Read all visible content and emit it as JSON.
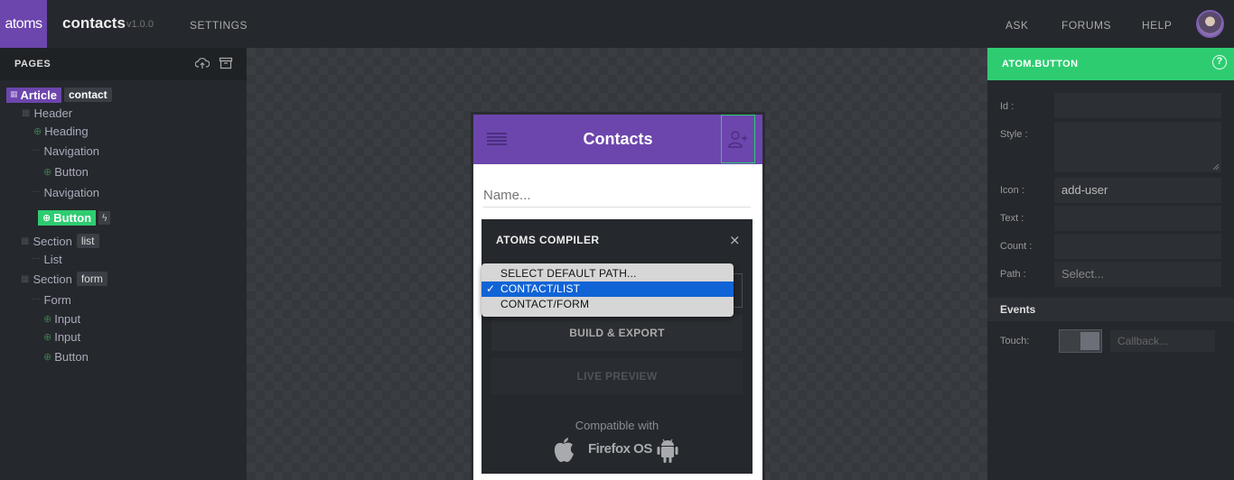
{
  "topbar": {
    "logo": "atoms",
    "app_name": "contacts",
    "version": "v1.0.0",
    "settings": "SETTINGS",
    "ask": "ASK",
    "forums": "FORUMS",
    "help": "HELP"
  },
  "pages_panel": {
    "title": "PAGES",
    "article_label": "Article",
    "article_id": "contact",
    "tree": {
      "header": "Header",
      "heading": "Heading",
      "navigation1": "Navigation",
      "button1": "Button",
      "navigation2": "Navigation",
      "button_selected": "Button",
      "section1": "Section",
      "section1_tag": "list",
      "list": "List",
      "section2": "Section",
      "section2_tag": "form",
      "form": "Form",
      "input1": "Input",
      "input2": "Input",
      "button3": "Button"
    }
  },
  "phone": {
    "title": "Contacts",
    "name_placeholder": "Name..."
  },
  "compiler_modal": {
    "title": "ATOMS COMPILER",
    "close": "×",
    "build_export": "BUILD & EXPORT",
    "live_preview": "LIVE PREVIEW",
    "compatible_with": "Compatible with",
    "firefox_os": "Firefox OS",
    "path_options": [
      "SELECT DEFAULT PATH...",
      "CONTACT/LIST",
      "CONTACT/FORM"
    ],
    "selected_path": "CONTACT/LIST",
    "check": "✓"
  },
  "properties": {
    "title": "ATOM.BUTTON",
    "help": "?",
    "id_label": "Id :",
    "style_label": "Style :",
    "icon_label": "Icon :",
    "icon_value": "add-user",
    "text_label": "Text :",
    "count_label": "Count :",
    "path_label": "Path :",
    "path_placeholder": "Select...",
    "events_title": "Events",
    "touch_label": "Touch:",
    "callback_placeholder": "Callback..."
  },
  "colors": {
    "brand_purple": "#6c46ad",
    "accent_green": "#2ecc71",
    "selection_blue": "#1164d6"
  }
}
